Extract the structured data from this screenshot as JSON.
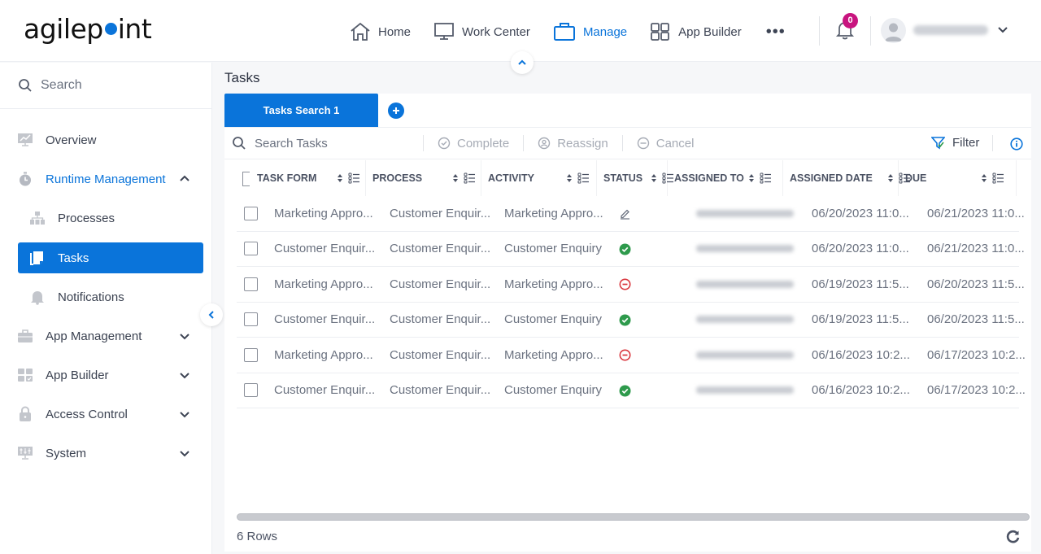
{
  "app": {
    "logo_text_left": "agilep",
    "logo_text_right": "int"
  },
  "topnav": {
    "items": [
      {
        "label": "Home",
        "icon": "home-icon",
        "active": false
      },
      {
        "label": "Work Center",
        "icon": "monitor-icon",
        "active": false
      },
      {
        "label": "Manage",
        "icon": "briefcase-icon",
        "active": true
      },
      {
        "label": "App Builder",
        "icon": "grid-icon",
        "active": false
      }
    ],
    "more_label": "•••",
    "notifications_count": "0",
    "accent_color": "#0a74da",
    "badge_color": "#c8147f"
  },
  "sidebar": {
    "search_placeholder": "Search",
    "items": [
      {
        "label": "Overview",
        "icon": "chart-monitor-icon"
      },
      {
        "label": "Runtime Management",
        "icon": "stopwatch-icon",
        "expanded": true
      },
      {
        "label": "Processes",
        "icon": "hierarchy-icon"
      },
      {
        "label": "Tasks",
        "icon": "tasks-icon",
        "selected": true
      },
      {
        "label": "Notifications",
        "icon": "bell-icon"
      },
      {
        "label": "App Management",
        "icon": "toolbox-icon"
      },
      {
        "label": "App Builder",
        "icon": "app-builder-icon"
      },
      {
        "label": "Access Control",
        "icon": "lock-icon"
      },
      {
        "label": "System",
        "icon": "system-icon"
      }
    ]
  },
  "main": {
    "title": "Tasks",
    "tabs": [
      {
        "label": "Tasks Search 1",
        "active": true
      }
    ],
    "toolbar": {
      "search_placeholder": "Search Tasks",
      "complete_label": "Complete",
      "reassign_label": "Reassign",
      "cancel_label": "Cancel",
      "filter_label": "Filter"
    },
    "columns": [
      "TASK FORM",
      "PROCESS",
      "ACTIVITY",
      "STATUS",
      "ASSIGNED TO",
      "ASSIGNED DATE",
      "DUE"
    ],
    "rows": [
      {
        "task_form": "Marketing Appro...",
        "process": "Customer Enquir...",
        "activity": "Marketing Appro...",
        "status": "in-progress",
        "assigned_date": "06/20/2023 11:0...",
        "due": "06/21/2023 11:0..."
      },
      {
        "task_form": "Customer Enquir...",
        "process": "Customer Enquir...",
        "activity": "Customer Enquiry",
        "status": "completed",
        "assigned_date": "06/20/2023 11:0...",
        "due": "06/21/2023 11:0..."
      },
      {
        "task_form": "Marketing Appro...",
        "process": "Customer Enquir...",
        "activity": "Marketing Appro...",
        "status": "cancelled",
        "assigned_date": "06/19/2023 11:5...",
        "due": "06/20/2023 11:5..."
      },
      {
        "task_form": "Customer Enquir...",
        "process": "Customer Enquir...",
        "activity": "Customer Enquiry",
        "status": "completed",
        "assigned_date": "06/19/2023 11:5...",
        "due": "06/20/2023 11:5..."
      },
      {
        "task_form": "Marketing Appro...",
        "process": "Customer Enquir...",
        "activity": "Marketing Appro...",
        "status": "cancelled",
        "assigned_date": "06/16/2023 10:2...",
        "due": "06/17/2023 10:2..."
      },
      {
        "task_form": "Customer Enquir...",
        "process": "Customer Enquir...",
        "activity": "Customer Enquiry",
        "status": "completed",
        "assigned_date": "06/16/2023 10:2...",
        "due": "06/17/2023 10:2..."
      }
    ],
    "row_count_label": "6 Rows",
    "status_colors": {
      "completed": "#2e9a4c",
      "cancelled": "#d9363e",
      "in-progress": "#6b7280"
    }
  }
}
